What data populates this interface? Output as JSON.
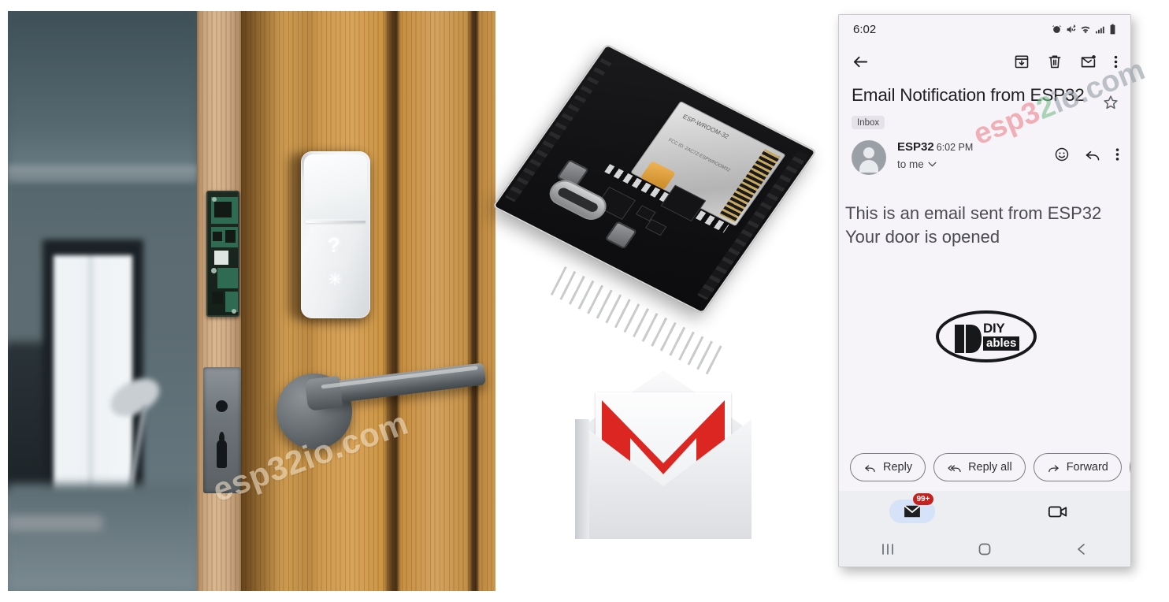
{
  "watermarks": {
    "photo": "esp32io.com",
    "phone_parts": [
      "esp3",
      "2",
      "io.com"
    ]
  },
  "photo": {
    "alt": "Wooden front door with smart lock, lever handle and door sensor module",
    "lock_glyph_top": "?",
    "lock_glyph_bottom": "✳"
  },
  "esp32": {
    "alt": "ESP32 ESP-WROOM-32 development board",
    "shield_label": "ESP-WROOM-32",
    "shield_sub": "FCC ID: 2AC7Z-ESPWROOM32"
  },
  "gmail": {
    "alt": "Gmail envelope logo",
    "letter_mark": "M"
  },
  "phone": {
    "status": {
      "time": "6:02",
      "icons": [
        "alarm-icon",
        "mute-icon",
        "wifi-icon",
        "signal-icon",
        "battery-icon"
      ]
    },
    "appbar": {
      "back": "back-arrow-icon",
      "archive": "archive-icon",
      "delete": "trash-icon",
      "mark_unread": "mark-unread-icon",
      "more": "more-vert-icon"
    },
    "email": {
      "subject": "Email Notification from ESP32",
      "label": "Inbox",
      "starred": false,
      "sender_name": "ESP32",
      "sender_time": "6:02 PM",
      "recipient": "to me",
      "body_lines": [
        "This is an email sent from ESP32",
        "Your door is opened"
      ],
      "logo": {
        "top_text": "DIY",
        "bottom_text": "ables"
      }
    },
    "actions": {
      "reply": "Reply",
      "reply_all": "Reply all",
      "forward": "Forward",
      "emoji": "emoji-icon"
    },
    "bottom_nav": {
      "mail_badge": "99+",
      "mail": "mail-icon",
      "meet": "video-camera-icon"
    },
    "sysnav": {
      "recents": "recents-icon",
      "home": "home-icon",
      "back": "back-icon"
    }
  },
  "colors": {
    "phone_bg": "#f7f4f9",
    "badge_red": "#c5221f",
    "nav_pill_blue": "#d6e2f7",
    "gmail_red": "#dc2621",
    "text_primary": "#1f1f21",
    "text_body": "#4a4c52"
  }
}
